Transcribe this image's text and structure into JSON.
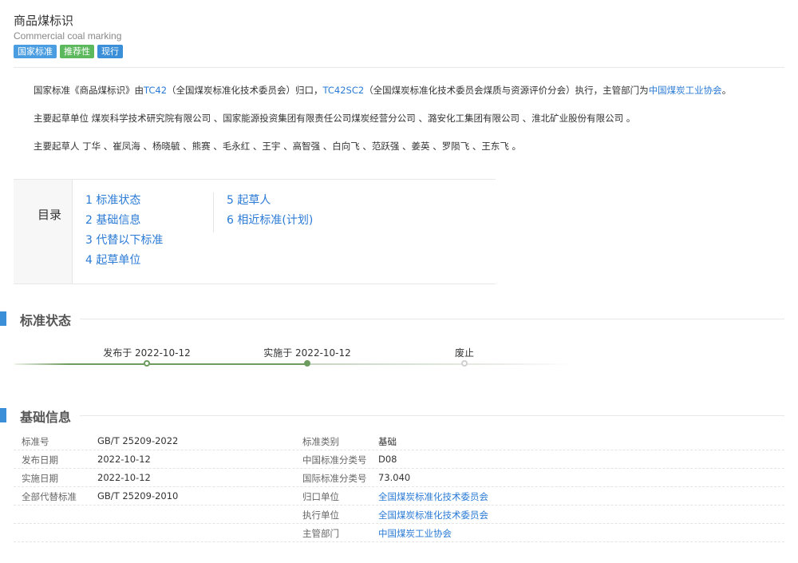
{
  "header": {
    "title": "商品煤标识",
    "subtitle": "Commercial coal marking",
    "tags": [
      "国家标准",
      "推荐性",
      "现行"
    ]
  },
  "summary": {
    "line1": {
      "p1": "国家标准《商品煤标识》由",
      "tc1": "TC42",
      "p2": "（全国煤炭标准化技术委员会）归口，",
      "tc2": "TC42SC2",
      "p3": "（全国煤炭标准化技术委员会煤质与资源评价分会）执行，主管部门为",
      "dept": "中国煤炭工业协会",
      "p4": "。"
    },
    "line2": "主要起草单位 煤炭科学技术研究院有限公司 、国家能源投资集团有限责任公司煤炭经营分公司 、潞安化工集团有限公司 、淮北矿业股份有限公司 。",
    "line3": "主要起草人 丁华 、崔凤海 、杨晓毓 、熊赛 、毛永红 、王宇 、高智强 、白向飞 、范跃强 、姜英 、罗陨飞 、王东飞 。"
  },
  "toc": {
    "label": "目录",
    "items": [
      "1 标准状态",
      "2 基础信息",
      "3 代替以下标准",
      "4 起草单位",
      "5 起草人",
      "6 相近标准(计划)"
    ]
  },
  "status": {
    "title": "标准状态",
    "steps": [
      {
        "label": "发布于 2022-10-12",
        "state": "done"
      },
      {
        "label": "实施于 2022-10-12",
        "state": "current"
      },
      {
        "label": "废止",
        "state": "pending"
      }
    ]
  },
  "basic": {
    "title": "基础信息",
    "left": [
      {
        "k": "标准号",
        "v": "GB/T 25209-2022"
      },
      {
        "k": "发布日期",
        "v": "2022-10-12"
      },
      {
        "k": "实施日期",
        "v": "2022-10-12"
      },
      {
        "k": "全部代替标准",
        "v": "GB/T 25209-2010"
      }
    ],
    "right": [
      {
        "k": "标准类别",
        "v": "基础"
      },
      {
        "k": "中国标准分类号",
        "v": "D08"
      },
      {
        "k": "国际标准分类号",
        "v": "73.040"
      },
      {
        "k": "归口单位",
        "v": "全国煤炭标准化技术委员会"
      },
      {
        "k": "执行单位",
        "v": "全国煤炭标准化技术委员会"
      },
      {
        "k": "主管部门",
        "v": "中国煤炭工业协会"
      }
    ]
  },
  "colors": {
    "accent": "#3a8fd8",
    "link": "#2b7bd6",
    "progress": "#6d9c5e"
  }
}
